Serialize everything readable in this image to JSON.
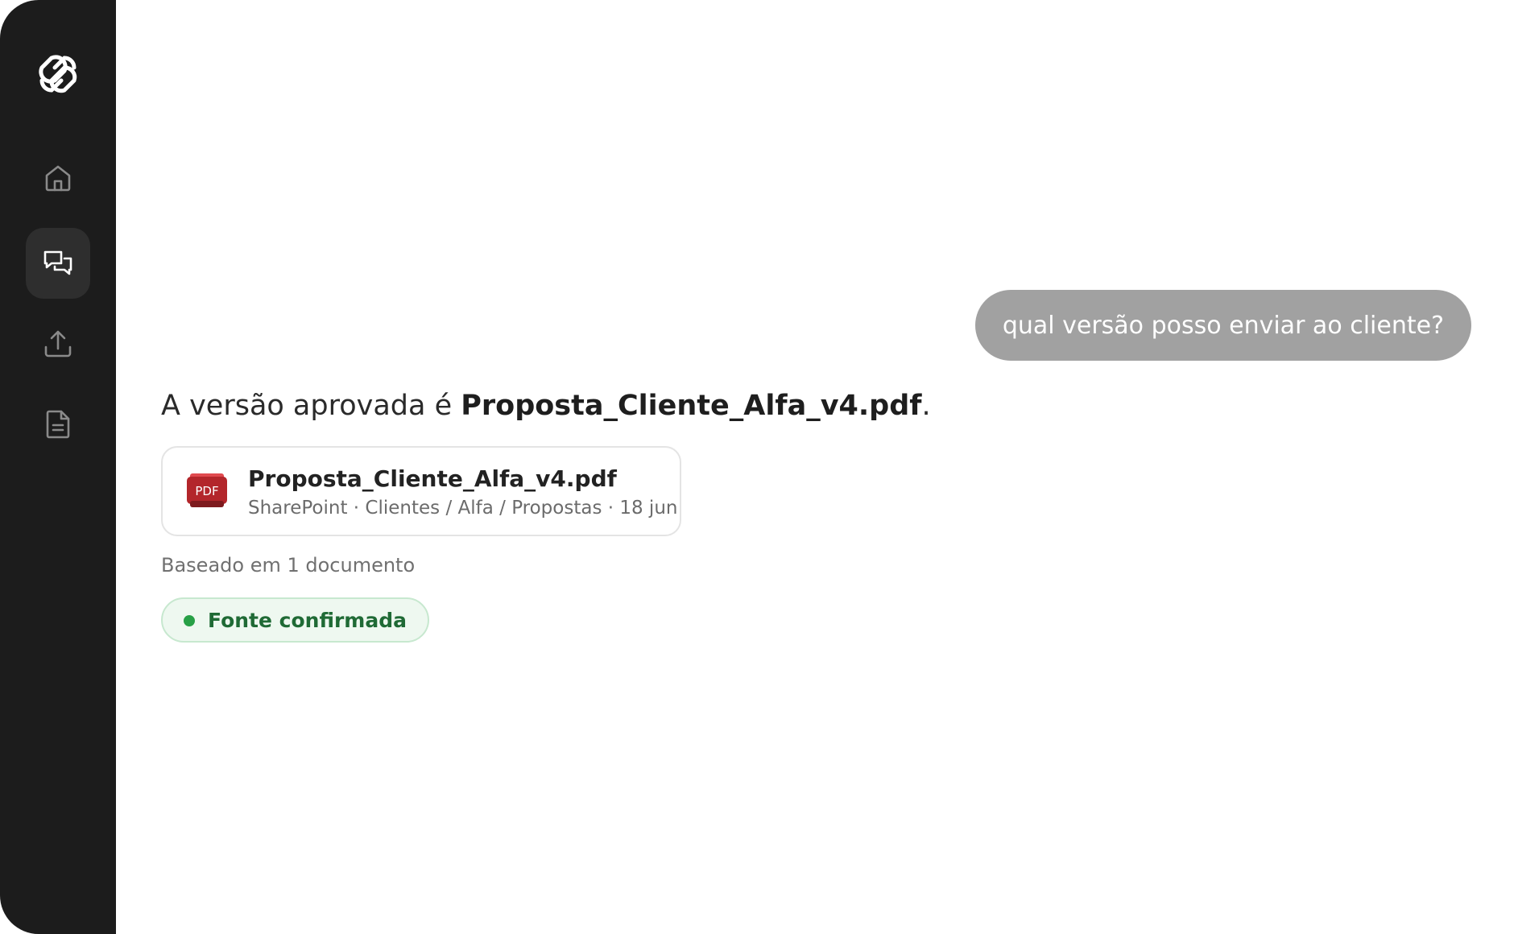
{
  "sidebar": {
    "logo_icon": "interlocking-rings-logo",
    "items": [
      {
        "icon": "home-icon",
        "active": false
      },
      {
        "icon": "chat-bubbles-icon",
        "active": true
      },
      {
        "icon": "upload-icon",
        "active": false
      },
      {
        "icon": "document-icon",
        "active": false
      }
    ]
  },
  "conversation": {
    "user_message": "qual versão posso enviar ao cliente?",
    "answer_prefix": "A versão aprovada é ",
    "answer_file": "Proposta_Cliente_Alfa_v4.pdf",
    "answer_suffix": ".",
    "source_card": {
      "icon_label": "PDF",
      "title": "Proposta_Cliente_Alfa_v4.pdf",
      "meta": "SharePoint · Clientes / Alfa / Propostas · 18 jun"
    },
    "based_on": "Baseado em 1 documento",
    "badge_label": "Fonte confirmada"
  },
  "colors": {
    "sidebar_bg": "#1c1c1c",
    "user_bubble_bg": "#a1a1a1",
    "badge_bg": "#eef8f0",
    "badge_text": "#1f6a35",
    "badge_dot": "#27a046",
    "pdf_red": "#c0282d"
  }
}
